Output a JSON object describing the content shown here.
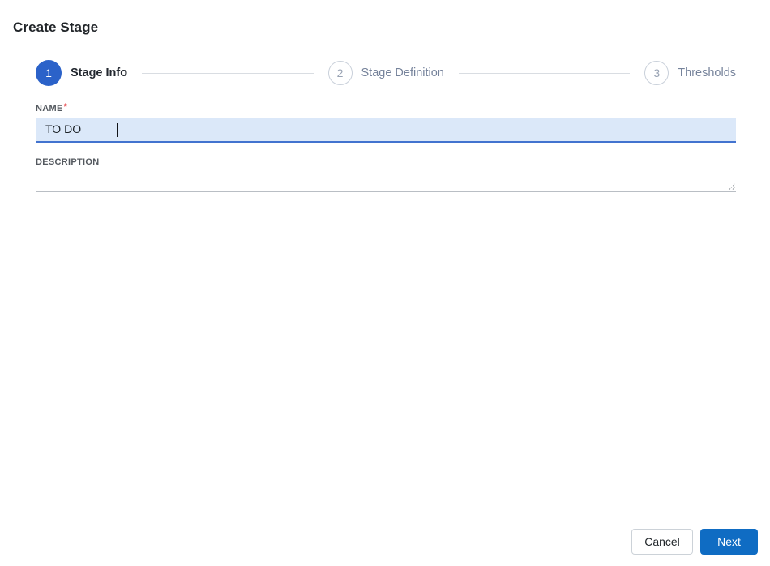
{
  "page": {
    "title": "Create Stage"
  },
  "stepper": {
    "steps": [
      {
        "number": "1",
        "label": "Stage Info",
        "state": "active"
      },
      {
        "number": "2",
        "label": "Stage Definition",
        "state": "upcoming"
      },
      {
        "number": "3",
        "label": "Thresholds",
        "state": "upcoming"
      }
    ]
  },
  "form": {
    "name": {
      "label": "NAME",
      "required_marker": "*",
      "value": "TO DO"
    },
    "description": {
      "label": "DESCRIPTION",
      "value": ""
    }
  },
  "footer": {
    "cancel_label": "Cancel",
    "next_label": "Next"
  },
  "colors": {
    "active_step_blue": "#2b62c9",
    "primary_button_blue": "#0f6cc3",
    "input_focus_bg": "#dbe8f9",
    "input_focus_border": "#4273cf",
    "required_asterisk_red": "#e5383d",
    "inactive_step_gray": "#76839b",
    "connector_gray": "#d9dde2"
  }
}
